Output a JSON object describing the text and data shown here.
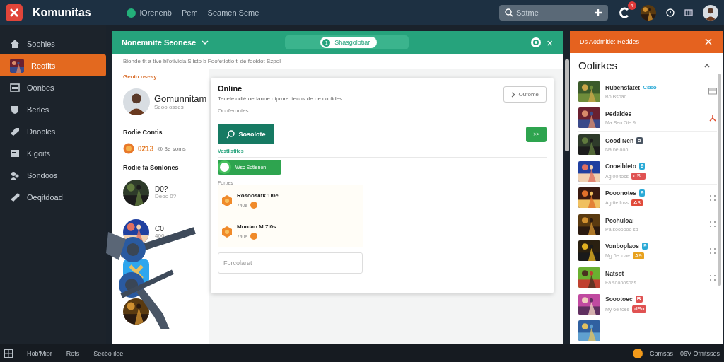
{
  "topbar": {
    "app_name": "Komunitas",
    "nav": [
      {
        "label": "lOrenenb",
        "icon": true
      },
      {
        "label": "Pem",
        "icon": false
      },
      {
        "label": "Seamen Seme",
        "icon": false
      }
    ],
    "search": {
      "placeholder": "Satme"
    },
    "notification_count": "4"
  },
  "sidebar": {
    "items": [
      {
        "label": "Soohles",
        "selected": false
      },
      {
        "label": "Reofits",
        "selected": true
      },
      {
        "label": "Oonbes",
        "selected": false
      },
      {
        "label": "Berles",
        "selected": false
      },
      {
        "label": "Dnobles",
        "selected": false
      },
      {
        "label": "Kigoits",
        "selected": false
      },
      {
        "label": "Sondoos",
        "selected": false
      },
      {
        "label": "Oeqitdoad",
        "selected": false
      }
    ]
  },
  "center_panel": {
    "title": "Nonemnite Seonese",
    "pill": {
      "badge": "1",
      "label": "Shasgolotiar"
    },
    "close": "×",
    "subtitle": "Bionde tit a tive bl'otivicia Slisto b Foofetiotio ti de fooidot Szpol",
    "profile_column": {
      "section": "Geoio osesy",
      "profile": {
        "name": "Gomunnitam",
        "meta": "Seoo osses"
      },
      "stats_heading": "Rodie Contis",
      "stats": {
        "value": "0213",
        "detail": "@ 3e soms"
      },
      "list_heading": "Rodie fa Sonlones",
      "members": [
        {
          "kind": "avatar",
          "name": "D0?",
          "meta": "Deoo 0?"
        },
        {
          "kind": "avatar",
          "name": "C0",
          "meta": "400"
        },
        {
          "kind": "app"
        },
        {
          "kind": "avatar"
        }
      ]
    },
    "dialog": {
      "title": "Online",
      "description": "Tecetelodiè oerlanne dipmre tiecos de de cortides.",
      "note": "Ocoferontes",
      "outline_button": "Oufome",
      "primary_button": "Sosolote",
      "small_button": ">>",
      "section_label": "Vestiistites",
      "toggle_label": "Wsc Sotienon",
      "toggle_on": true,
      "list_label": "Forbes",
      "items": [
        {
          "title": "Rosoosatk 1i0e",
          "meta": "7/i0e"
        },
        {
          "title": "Mordan M 7i0s",
          "meta": "7/i0e"
        }
      ],
      "input_placeholder": "Forcolaret"
    }
  },
  "right_panel": {
    "title": "Ds Aodmitie: Reddes",
    "list_title": "Oolirkes",
    "items": [
      {
        "kind": "card",
        "name": "Rubensfatet",
        "label": {
          "text": "Csso",
          "color": "#29a9d6"
        },
        "meta": "Bo Bsoad"
      },
      {
        "kind": "person",
        "name": "Pedaldes",
        "meta": "Ma Seo Oie 9"
      },
      {
        "kind": "plain",
        "name": "Cood Nen",
        "badge": {
          "text": "5",
          "color": "#4a5563"
        },
        "meta": "Na 6e ooo"
      },
      {
        "kind": "plain",
        "name": "Cooeibleto",
        "badge": {
          "text": "9",
          "color": "#29a9d6"
        },
        "meta": "Ag 00 toss",
        "tag": {
          "text": "dSo",
          "color": "#e05252"
        }
      },
      {
        "kind": "dots",
        "name": "Pooonotes",
        "badge": {
          "text": "9",
          "color": "#29a9d6"
        },
        "meta": "Ag 6e Ioss",
        "tag": {
          "text": "A3",
          "color": "#e04a3a"
        }
      },
      {
        "kind": "dots",
        "name": "Pochuloai",
        "meta": "Pa soooooo sd"
      },
      {
        "kind": "dots",
        "name": "Vonboplaos",
        "badge": {
          "text": "9",
          "color": "#29a9d6"
        },
        "meta": "Mg 6e toae",
        "tag": {
          "text": "A9",
          "color": "#e8a21f"
        }
      },
      {
        "kind": "dots",
        "name": "Natsot",
        "meta": "Fa soooosoas"
      },
      {
        "kind": "plain",
        "name": "Soootoec",
        "badge": {
          "text": "B",
          "color": "#e05252"
        },
        "meta": "My 6e toes",
        "tag": {
          "text": "dSo",
          "color": "#e05252"
        }
      },
      {
        "kind": "thumbnail"
      }
    ]
  },
  "status_bar": {
    "left": [
      "Hob'Mior",
      "Rots",
      "Secbo ilee"
    ],
    "right": [
      "Comsas",
      "06V Ofnitsses"
    ]
  }
}
